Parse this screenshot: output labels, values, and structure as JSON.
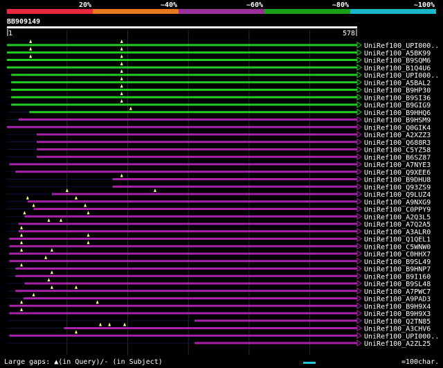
{
  "identity_scale": {
    "labels": [
      "20%",
      "~40%",
      "~60%",
      "~80%",
      "~100%"
    ],
    "colors": [
      "#e8283c",
      "#e87820",
      "#9a3098",
      "#18a018",
      "#18b8c8"
    ]
  },
  "query": {
    "id": "BB909149",
    "start": "1",
    "end": "578"
  },
  "colors": {
    "top": "#22cc22",
    "bottom": "#aa22aa",
    "gap_marker": "#ffff88",
    "scale_bar": "#22c8d8"
  },
  "footer": {
    "gaps_legend": "Large gaps: ▲(in Query)/- (in Subject)",
    "scale_label": "=100char."
  },
  "chart_data": {
    "type": "alignment-map",
    "query_length": 578,
    "hits": [
      {
        "name": "UniRef100_UPI000..",
        "identity": "~80%",
        "start": 1,
        "end": 578,
        "query_gaps": [
          40,
          190
        ]
      },
      {
        "name": "UniRef100_A5BK99",
        "identity": "~80%",
        "start": 1,
        "end": 578,
        "query_gaps": [
          40,
          190
        ]
      },
      {
        "name": "UniRef100_B9SQM6",
        "identity": "~80%",
        "start": 1,
        "end": 578,
        "query_gaps": [
          40,
          190
        ]
      },
      {
        "name": "UniRef100_B1Q4U6",
        "identity": "~80%",
        "start": 1,
        "end": 578,
        "query_gaps": [
          190
        ]
      },
      {
        "name": "UniRef100_UPI000..",
        "identity": "~80%",
        "start": 8,
        "end": 578,
        "query_gaps": [
          190
        ]
      },
      {
        "name": "UniRef100_A5BAL2",
        "identity": "~80%",
        "start": 8,
        "end": 578,
        "query_gaps": [
          190
        ]
      },
      {
        "name": "UniRef100_B9HP30",
        "identity": "~80%",
        "start": 8,
        "end": 578,
        "query_gaps": [
          190
        ]
      },
      {
        "name": "UniRef100_B9SI36",
        "identity": "~80%",
        "start": 8,
        "end": 578,
        "query_gaps": [
          190
        ]
      },
      {
        "name": "UniRef100_B9GIG9",
        "identity": "~80%",
        "start": 8,
        "end": 578,
        "query_gaps": [
          190
        ]
      },
      {
        "name": "UniRef100_B9HHQ6",
        "identity": "~80%",
        "start": 38,
        "end": 578,
        "query_gaps": [
          205
        ]
      },
      {
        "name": "UniRef100_B9HSM9",
        "identity": "~60%",
        "start": 20,
        "end": 578,
        "query_gaps": []
      },
      {
        "name": "UniRef100_Q0GIK4",
        "identity": "~60%",
        "start": 1,
        "end": 578,
        "query_gaps": []
      },
      {
        "name": "UniRef100_A2XZZ3",
        "identity": "~60%",
        "start": 50,
        "end": 578,
        "query_gaps": []
      },
      {
        "name": "UniRef100_Q688R3",
        "identity": "~60%",
        "start": 50,
        "end": 578,
        "query_gaps": []
      },
      {
        "name": "UniRef100_C5YZ58",
        "identity": "~60%",
        "start": 50,
        "end": 578,
        "query_gaps": []
      },
      {
        "name": "UniRef100_B6SZ87",
        "identity": "~60%",
        "start": 50,
        "end": 578,
        "query_gaps": []
      },
      {
        "name": "UniRef100_A7NYE3",
        "identity": "~60%",
        "start": 5,
        "end": 578,
        "query_gaps": []
      },
      {
        "name": "UniRef100_Q9XEE6",
        "identity": "~60%",
        "start": 15,
        "end": 578,
        "query_gaps": []
      },
      {
        "name": "UniRef100_B9DHU8",
        "identity": "~60%",
        "start": 175,
        "end": 578,
        "query_gaps": [
          190
        ]
      },
      {
        "name": "UniRef100_Q93ZS9",
        "identity": "~60%",
        "start": 175,
        "end": 578,
        "query_gaps": []
      },
      {
        "name": "UniRef100_Q9LUZ4",
        "identity": "~60%",
        "start": 75,
        "end": 578,
        "query_gaps": [
          100,
          245
        ]
      },
      {
        "name": "UniRef100_A9NXG9",
        "identity": "~60%",
        "start": 35,
        "end": 578,
        "query_gaps": [
          35,
          115
        ]
      },
      {
        "name": "UniRef100_C0PPY9",
        "identity": "~60%",
        "start": 45,
        "end": 578,
        "query_gaps": [
          45,
          130
        ]
      },
      {
        "name": "UniRef100_A2Q3L5",
        "identity": "~60%",
        "start": 30,
        "end": 578,
        "query_gaps": [
          30,
          135
        ]
      },
      {
        "name": "UniRef100_A7Q2A5",
        "identity": "~60%",
        "start": 20,
        "end": 578,
        "query_gaps": [
          70,
          90
        ]
      },
      {
        "name": "UniRef100_A3ALR0",
        "identity": "~60%",
        "start": 20,
        "end": 578,
        "query_gaps": [
          25
        ]
      },
      {
        "name": "UniRef100_Q1QEL1",
        "identity": "~60%",
        "start": 5,
        "end": 578,
        "query_gaps": [
          25,
          135
        ]
      },
      {
        "name": "UniRef100_C5WNW0",
        "identity": "~60%",
        "start": 5,
        "end": 578,
        "query_gaps": [
          25,
          135
        ]
      },
      {
        "name": "UniRef100_C0HHX7",
        "identity": "~60%",
        "start": 5,
        "end": 578,
        "query_gaps": [
          25,
          75
        ]
      },
      {
        "name": "UniRef100_B9SL49",
        "identity": "~60%",
        "start": 5,
        "end": 578,
        "query_gaps": [
          65
        ]
      },
      {
        "name": "UniRef100_B9HNP7",
        "identity": "~60%",
        "start": 15,
        "end": 578,
        "query_gaps": [
          25
        ]
      },
      {
        "name": "UniRef100_B9I160",
        "identity": "~60%",
        "start": 15,
        "end": 578,
        "query_gaps": [
          75
        ]
      },
      {
        "name": "UniRef100_B9SL48",
        "identity": "~60%",
        "start": 30,
        "end": 578,
        "query_gaps": [
          70
        ]
      },
      {
        "name": "UniRef100_A7PWC7",
        "identity": "~60%",
        "start": 15,
        "end": 578,
        "query_gaps": [
          75,
          115
        ]
      },
      {
        "name": "UniRef100_A9PAD3",
        "identity": "~60%",
        "start": 28,
        "end": 578,
        "query_gaps": [
          45
        ]
      },
      {
        "name": "UniRef100_B9H9X4",
        "identity": "~60%",
        "start": 5,
        "end": 578,
        "query_gaps": [
          25,
          150
        ]
      },
      {
        "name": "UniRef100_B9H9X3",
        "identity": "~60%",
        "start": 5,
        "end": 578,
        "query_gaps": [
          25
        ]
      },
      {
        "name": "UniRef100_Q2TN85",
        "identity": "~60%",
        "start": 310,
        "end": 578,
        "query_gaps": []
      },
      {
        "name": "UniRef100_A3CHV6",
        "identity": "~60%",
        "start": 95,
        "end": 578,
        "query_gaps": [
          155,
          170,
          195
        ]
      },
      {
        "name": "UniRef100_UPI000..",
        "identity": "~60%",
        "start": 5,
        "end": 578,
        "query_gaps": [
          115
        ]
      },
      {
        "name": "UniRef100_A2ZL25",
        "identity": "~60%",
        "start": 310,
        "end": 578,
        "query_gaps": []
      }
    ]
  }
}
